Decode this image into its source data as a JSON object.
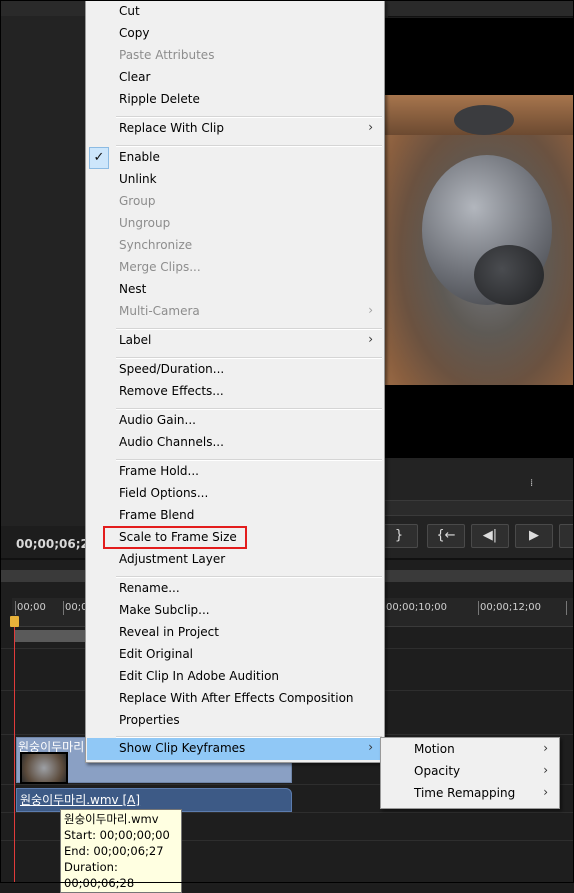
{
  "monitor": {
    "timecode": "00;00;06;2",
    "transport": [
      "}",
      "{←",
      "◀|",
      "▶"
    ]
  },
  "timeline": {
    "ruler_labels": [
      "00;00",
      "00;0",
      "00;00;10;00",
      "00;00;12;00"
    ],
    "video_clip_title": "원숭이두마리",
    "audio_clip_title": "원숭이두마리.wmv [A]"
  },
  "tooltip": {
    "name": "원숭이두마리.wmv",
    "start": "Start: 00;00;00;00",
    "end": "End: 00;00;06;27",
    "duration": "Duration: 00;00;06;28"
  },
  "context_menu": {
    "items": [
      {
        "label": "Cut",
        "enabled": true
      },
      {
        "label": "Copy",
        "enabled": true
      },
      {
        "label": "Paste Attributes",
        "enabled": false
      },
      {
        "label": "Clear",
        "enabled": true
      },
      {
        "label": "Ripple Delete",
        "enabled": true
      },
      {
        "label": "Replace With Clip",
        "enabled": true,
        "submenu": true
      },
      {
        "label": "Enable",
        "enabled": true,
        "checked": true
      },
      {
        "label": "Unlink",
        "enabled": true
      },
      {
        "label": "Group",
        "enabled": false
      },
      {
        "label": "Ungroup",
        "enabled": false
      },
      {
        "label": "Synchronize",
        "enabled": false
      },
      {
        "label": "Merge Clips...",
        "enabled": false
      },
      {
        "label": "Nest",
        "enabled": true
      },
      {
        "label": "Multi-Camera",
        "enabled": false,
        "submenu": true
      },
      {
        "label": "Label",
        "enabled": true,
        "submenu": true
      },
      {
        "label": "Speed/Duration...",
        "enabled": true
      },
      {
        "label": "Remove Effects...",
        "enabled": true
      },
      {
        "label": "Audio Gain...",
        "enabled": true
      },
      {
        "label": "Audio Channels...",
        "enabled": true
      },
      {
        "label": "Frame Hold...",
        "enabled": true
      },
      {
        "label": "Field Options...",
        "enabled": true
      },
      {
        "label": "Frame Blend",
        "enabled": true
      },
      {
        "label": "Scale to Frame Size",
        "enabled": true,
        "annotated": true
      },
      {
        "label": "Adjustment Layer",
        "enabled": true
      },
      {
        "label": "Rename...",
        "enabled": true
      },
      {
        "label": "Make Subclip...",
        "enabled": true
      },
      {
        "label": "Reveal in Project",
        "enabled": true
      },
      {
        "label": "Edit Original",
        "enabled": true
      },
      {
        "label": "Edit Clip In Adobe Audition",
        "enabled": true
      },
      {
        "label": "Replace With After Effects Composition",
        "enabled": true
      },
      {
        "label": "Properties",
        "enabled": true
      },
      {
        "label": "Show Clip Keyframes",
        "enabled": true,
        "submenu": true,
        "highlighted": true
      }
    ],
    "arrow": "›",
    "check": "✓"
  },
  "submenu": {
    "items": [
      "Motion",
      "Opacity",
      "Time Remapping"
    ]
  }
}
